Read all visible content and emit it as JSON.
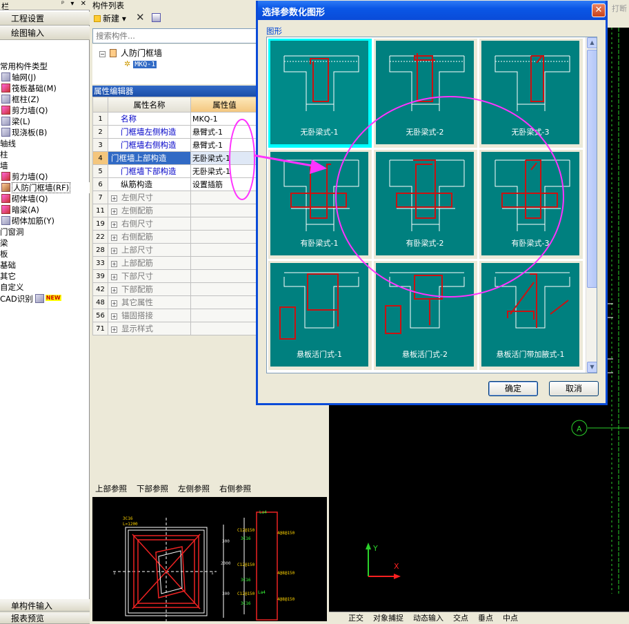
{
  "left_panel": {
    "title": "栏",
    "title_buttons": "ᵖ ▾ ✕",
    "nav_buttons": [
      "工程设置",
      "绘图输入"
    ],
    "tree": [
      {
        "label": "常用构件类型",
        "indent": 0,
        "icon": ""
      },
      {
        "label": "轴网(J)",
        "indent": 1,
        "icon": "grid-icon"
      },
      {
        "label": "筏板基础(M)",
        "indent": 1,
        "icon": "raft-icon"
      },
      {
        "label": "框柱(Z)",
        "indent": 1,
        "icon": "column-icon"
      },
      {
        "label": "剪力墙(Q)",
        "indent": 1,
        "icon": "shear-wall-icon"
      },
      {
        "label": "梁(L)",
        "indent": 1,
        "icon": "beam-icon"
      },
      {
        "label": "现浇板(B)",
        "indent": 1,
        "icon": "slab-icon"
      },
      {
        "label": "轴线",
        "indent": 0,
        "icon": ""
      },
      {
        "label": "柱",
        "indent": 0,
        "icon": ""
      },
      {
        "label": "墙",
        "indent": 0,
        "icon": ""
      },
      {
        "label": "剪力墙(Q)",
        "indent": 1,
        "icon": "shear-wall-icon"
      },
      {
        "label": "人防门框墙(RF)",
        "indent": 1,
        "icon": "civil-defense-door-icon"
      },
      {
        "label": "砌体墙(Q)",
        "indent": 1,
        "icon": "masonry-wall-icon"
      },
      {
        "label": "暗梁(A)",
        "indent": 1,
        "icon": "hidden-beam-icon"
      },
      {
        "label": "砌体加筋(Y)",
        "indent": 1,
        "icon": "masonry-rebar-icon"
      },
      {
        "label": "门窗洞",
        "indent": 0,
        "icon": ""
      },
      {
        "label": "梁",
        "indent": 0,
        "icon": ""
      },
      {
        "label": "板",
        "indent": 0,
        "icon": ""
      },
      {
        "label": "基础",
        "indent": 0,
        "icon": ""
      },
      {
        "label": "其它",
        "indent": 0,
        "icon": ""
      },
      {
        "label": "自定义",
        "indent": 0,
        "icon": ""
      },
      {
        "label": "CAD识别",
        "indent": 0,
        "icon": "cad-icon",
        "badge": "NEW"
      }
    ],
    "selected_tree_item": "人防门框墙(RF)",
    "bottom_buttons": [
      "单构件输入",
      "报表预览"
    ]
  },
  "component_list": {
    "title": "构件列表",
    "new_label": "新建",
    "delete_symbol": "✕",
    "search_placeholder": "搜索构件...",
    "tree_parent": "人防门框墙",
    "tree_child": "MKQ-1"
  },
  "property_editor": {
    "title": "属性编辑器",
    "col_name": "属性名称",
    "col_value": "属性值",
    "rows": [
      {
        "num": "1",
        "name": "名称",
        "value": "MKQ-1",
        "style": "blue",
        "expand": false
      },
      {
        "num": "2",
        "name": "门框墙左侧构造",
        "value": "悬臂式-1",
        "style": "blue",
        "expand": false
      },
      {
        "num": "3",
        "name": "门框墙右侧构造",
        "value": "悬臂式-1",
        "style": "blue",
        "expand": false
      },
      {
        "num": "4",
        "name": "门框墙上部构造",
        "value": "无卧梁式-1",
        "style": "sel",
        "expand": false
      },
      {
        "num": "5",
        "name": "门框墙下部构造",
        "value": "无卧梁式-1",
        "style": "blue",
        "expand": false
      },
      {
        "num": "6",
        "name": "纵筋构造",
        "value": "设置插筋",
        "style": "plain",
        "expand": false
      },
      {
        "num": "7",
        "name": "左侧尺寸",
        "value": "",
        "style": "gray",
        "expand": true
      },
      {
        "num": "11",
        "name": "左侧配筋",
        "value": "",
        "style": "gray",
        "expand": true
      },
      {
        "num": "19",
        "name": "右侧尺寸",
        "value": "",
        "style": "gray",
        "expand": true
      },
      {
        "num": "22",
        "name": "右侧配筋",
        "value": "",
        "style": "gray",
        "expand": true
      },
      {
        "num": "28",
        "name": "上部尺寸",
        "value": "",
        "style": "gray",
        "expand": true
      },
      {
        "num": "33",
        "name": "上部配筋",
        "value": "",
        "style": "gray",
        "expand": true
      },
      {
        "num": "39",
        "name": "下部尺寸",
        "value": "",
        "style": "gray",
        "expand": true
      },
      {
        "num": "42",
        "name": "下部配筋",
        "value": "",
        "style": "gray",
        "expand": true
      },
      {
        "num": "48",
        "name": "其它属性",
        "value": "",
        "style": "gray",
        "expand": true
      },
      {
        "num": "56",
        "name": "锚固搭接",
        "value": "",
        "style": "gray",
        "expand": true
      },
      {
        "num": "71",
        "name": "显示样式",
        "value": "",
        "style": "gray",
        "expand": true
      }
    ]
  },
  "preview": {
    "tabs": [
      "上部参照",
      "下部参照",
      "左侧参照",
      "右侧参照"
    ]
  },
  "canvas": {
    "top_right_text": "打断",
    "axis_label": "A",
    "x_label": "X",
    "y_label": "Y"
  },
  "statusbar": {
    "items": [
      "正交",
      "对象捕捉",
      "动态输入",
      "交点",
      "垂点",
      "中点"
    ]
  },
  "dialog": {
    "title": "选择参数化图形",
    "close_symbol": "✕",
    "group_label": "图形",
    "shapes": [
      {
        "label": "无卧梁式-1",
        "selected": true
      },
      {
        "label": "无卧梁式-2",
        "selected": false
      },
      {
        "label": "无卧梁式-3",
        "selected": false
      },
      {
        "label": "有卧梁式-1",
        "selected": false
      },
      {
        "label": "有卧梁式-2",
        "selected": false
      },
      {
        "label": "有卧梁式-3",
        "selected": false
      },
      {
        "label": "悬板活门式-1",
        "selected": false
      },
      {
        "label": "悬板活门式-2",
        "selected": false
      },
      {
        "label": "悬板活门带加腋式-1",
        "selected": false
      }
    ],
    "ok_label": "确定",
    "cancel_label": "取消"
  },
  "colors": {
    "cell_face": "#00807f",
    "selected_cell": "#00ffff",
    "annotation": "#ff33ff",
    "rebar": "#cc1111"
  }
}
